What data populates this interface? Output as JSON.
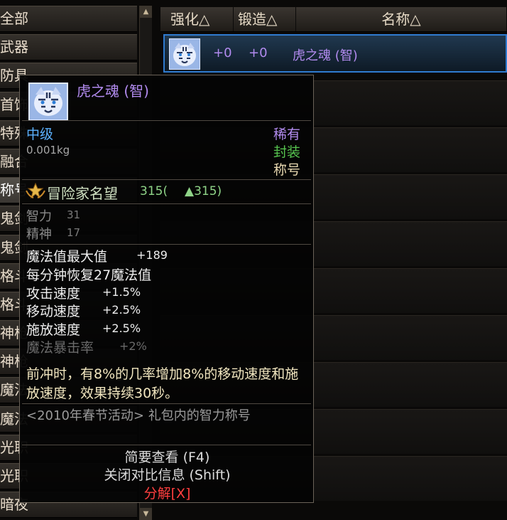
{
  "categories": [
    {
      "label": "全部"
    },
    {
      "label": "武器"
    },
    {
      "label": "防具"
    },
    {
      "label": "首饰"
    },
    {
      "label": "特殊"
    },
    {
      "label": "融合"
    },
    {
      "label": "称号",
      "selected": true
    },
    {
      "label": "鬼剑"
    },
    {
      "label": "鬼剑"
    },
    {
      "label": "格斗"
    },
    {
      "label": "格斗"
    },
    {
      "label": "神枪"
    },
    {
      "label": "神枪"
    },
    {
      "label": "魔法"
    },
    {
      "label": "魔法"
    },
    {
      "label": "光职"
    },
    {
      "label": "光职"
    },
    {
      "label": "暗夜"
    }
  ],
  "columns": {
    "strength": "强化△",
    "forge": "锻造△",
    "name": "名称△"
  },
  "result": {
    "strength": "+0",
    "forge": "+0",
    "name": "虎之魂 (智)"
  },
  "tooltip": {
    "item_name": "虎之魂 (智)",
    "grade": "中级",
    "weight": "0.001kg",
    "rarity": "稀有",
    "sealed": "封装",
    "type": "称号",
    "fame_label": "冒险家名望",
    "fame_value": "315(",
    "fame_up": "▲315)",
    "attributes": [
      {
        "name": "智力",
        "value": "31"
      },
      {
        "name": "精神",
        "value": "17"
      }
    ],
    "stats": [
      {
        "name": "魔法值最大值",
        "value": "+189"
      },
      {
        "name": "每分钟恢复27魔法值",
        "value": ""
      },
      {
        "name": "攻击速度",
        "value": "+1.5%"
      },
      {
        "name": "移动速度",
        "value": "+2.5%"
      },
      {
        "name": "施放速度",
        "value": "+2.5%"
      }
    ],
    "stat_dim": {
      "name": "魔法暴击率",
      "value": "+2%"
    },
    "description": "前冲时，有8%的几率增加8%的移动速度和施放速度，效果持续30秒。",
    "source": "<2010年春节活动> 礼包内的智力称号",
    "action_brief": "简要查看 (F4)",
    "action_compare": "关闭对比信息 (Shift)",
    "action_dismantle": "分解[X]"
  },
  "colors": {
    "epic_purple": "#b28bef",
    "sealed_green": "#56c44f",
    "grade_blue": "#5bb1ff",
    "dismantle_red": "#ff3e3e"
  },
  "icons": {
    "item": "white-tiger-icon",
    "fame": "fame-emblem-icon"
  }
}
